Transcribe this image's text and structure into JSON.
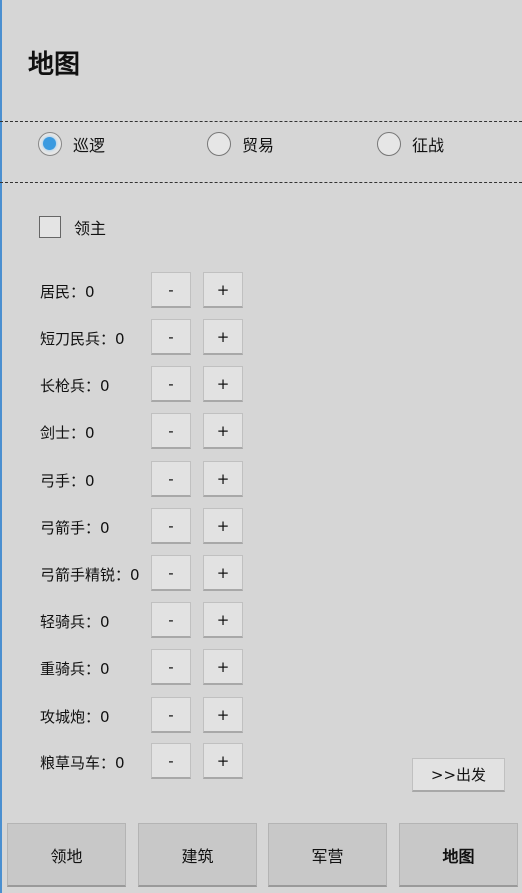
{
  "title": "地图",
  "modes": [
    {
      "label": "巡逻",
      "checked": true
    },
    {
      "label": "贸易",
      "checked": false
    },
    {
      "label": "征战",
      "checked": false
    }
  ],
  "lord": {
    "label": "领主",
    "checked": false
  },
  "units": [
    {
      "label": "居民：0"
    },
    {
      "label": "短刀民兵：0"
    },
    {
      "label": "长枪兵：0"
    },
    {
      "label": "剑士：0"
    },
    {
      "label": "弓手：0"
    },
    {
      "label": "弓箭手：0"
    },
    {
      "label": "弓箭手精锐：0"
    },
    {
      "label": "轻骑兵：0"
    },
    {
      "label": "重骑兵：0"
    },
    {
      "label": "攻城炮：0"
    },
    {
      "label": "粮草马车：0"
    }
  ],
  "controls": {
    "minus": "-",
    "plus": "+"
  },
  "depart_label": ">>出发",
  "nav": [
    {
      "label": "领地"
    },
    {
      "label": "建筑"
    },
    {
      "label": "军营"
    },
    {
      "label": "地图",
      "active": true
    }
  ]
}
